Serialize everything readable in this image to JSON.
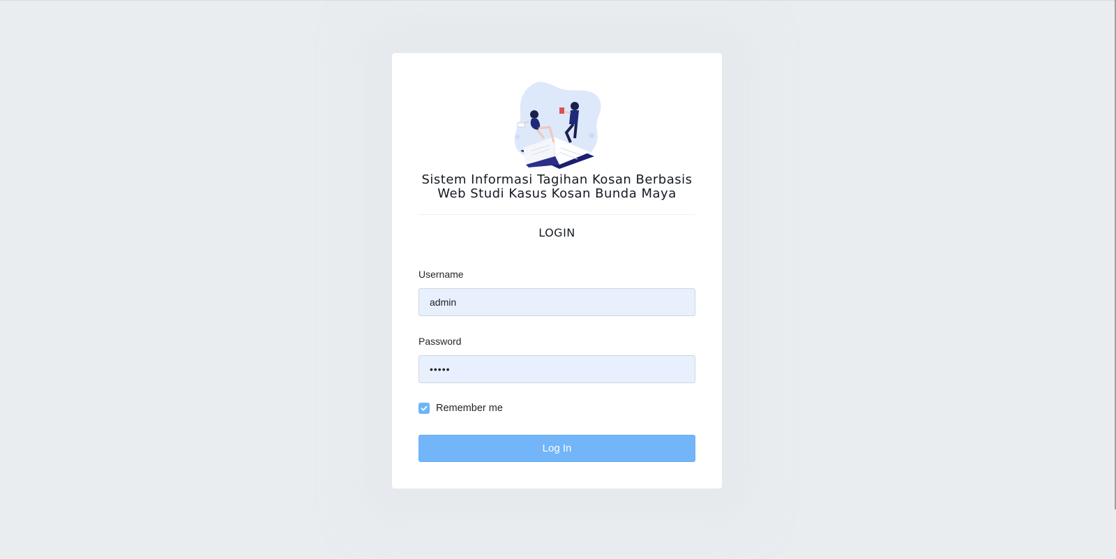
{
  "app": {
    "title": "Sistem Informasi Tagihan Kosan Berbasis Web Studi Kasus Kosan Bunda Maya"
  },
  "login": {
    "heading": "LOGIN",
    "username_label": "Username",
    "username_value": "admin",
    "password_label": "Password",
    "password_value": "•••••",
    "remember_label": "Remember me",
    "remember_checked": true,
    "submit_label": "Log In"
  },
  "icons": {
    "illustration": "reading-book-illustration",
    "checkbox": "check-icon"
  },
  "colors": {
    "background": "#e9edf0",
    "card": "#ffffff",
    "input_fill": "#e8f0fe",
    "accent": "#72b5f8",
    "text": "#141a22"
  }
}
